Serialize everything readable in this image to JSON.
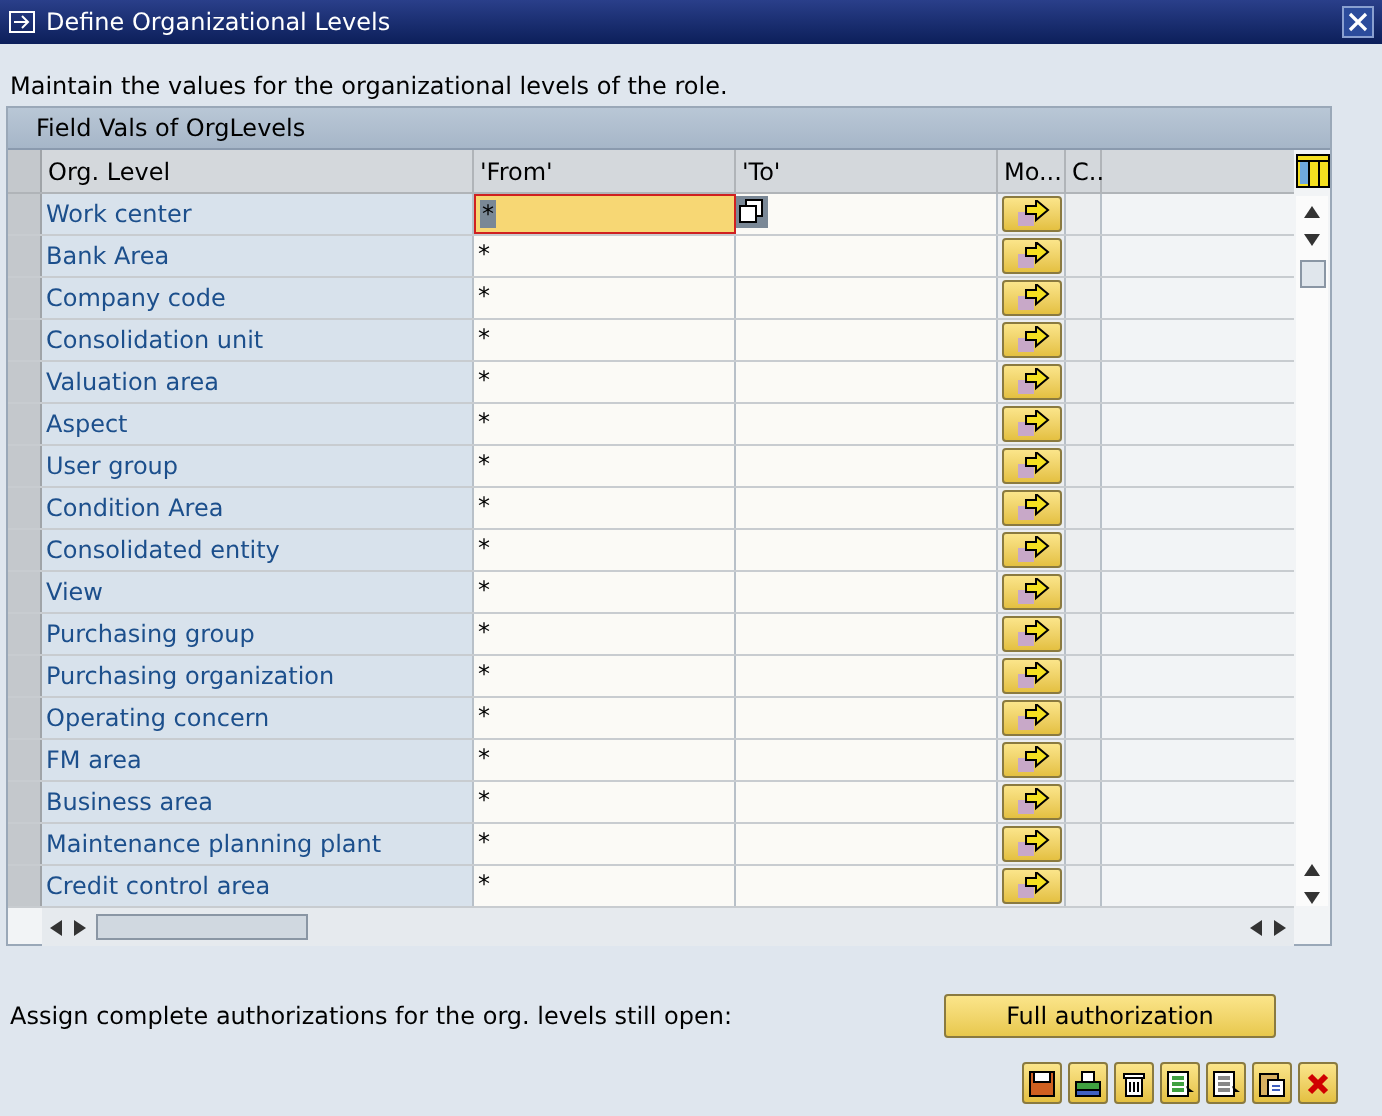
{
  "window": {
    "title": "Define Organizational Levels"
  },
  "instruction": "Maintain the values for the organizational levels of the role.",
  "table": {
    "title": "Field Vals of OrgLevels",
    "columns": [
      "Org. Level",
      "'From'",
      "'To'",
      "Mo...",
      "C.."
    ],
    "rows": [
      {
        "org_level": "Work center",
        "from": "*",
        "focused": true
      },
      {
        "org_level": "Bank Area",
        "from": "*",
        "focused": false
      },
      {
        "org_level": "Company code",
        "from": "*",
        "focused": false
      },
      {
        "org_level": "Consolidation unit",
        "from": "*",
        "focused": false
      },
      {
        "org_level": "Valuation area",
        "from": "*",
        "focused": false
      },
      {
        "org_level": "Aspect",
        "from": "*",
        "focused": false
      },
      {
        "org_level": "User group",
        "from": "*",
        "focused": false
      },
      {
        "org_level": "Condition Area",
        "from": "*",
        "focused": false
      },
      {
        "org_level": "Consolidated entity",
        "from": "*",
        "focused": false
      },
      {
        "org_level": "View",
        "from": "*",
        "focused": false
      },
      {
        "org_level": "Purchasing group",
        "from": "*",
        "focused": false
      },
      {
        "org_level": "Purchasing organization",
        "from": "*",
        "focused": false
      },
      {
        "org_level": "Operating concern",
        "from": "*",
        "focused": false
      },
      {
        "org_level": "FM area",
        "from": "*",
        "focused": false
      },
      {
        "org_level": "Business area",
        "from": "*",
        "focused": false
      },
      {
        "org_level": "Maintenance planning plant",
        "from": "*",
        "focused": false
      },
      {
        "org_level": "Credit control area",
        "from": "*",
        "focused": false
      }
    ]
  },
  "full_auth": {
    "label": "Assign complete authorizations for the org. levels still open:",
    "button": "Full authorization"
  },
  "toolbar": [
    {
      "kind": "save"
    },
    {
      "kind": "print"
    },
    {
      "kind": "delete"
    },
    {
      "kind": "select"
    },
    {
      "kind": "deselect"
    },
    {
      "kind": "paste"
    },
    {
      "kind": "cancel"
    }
  ]
}
